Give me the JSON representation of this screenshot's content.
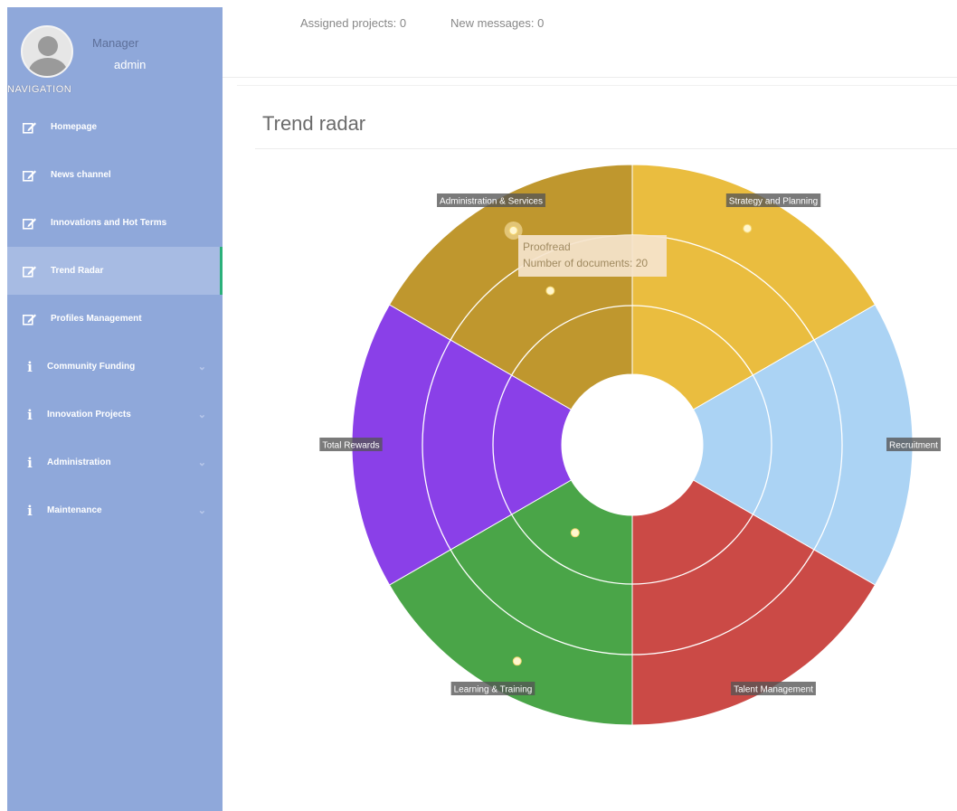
{
  "user": {
    "role": "Manager",
    "name": "admin"
  },
  "nav": {
    "header": "NAVIGATION",
    "items": [
      {
        "label": "Homepage",
        "icon": "edit-icon"
      },
      {
        "label": "News channel",
        "icon": "edit-icon"
      },
      {
        "label": "Innovations and Hot Terms",
        "icon": "edit-icon"
      },
      {
        "label": "Trend Radar",
        "icon": "edit-icon",
        "active": true
      },
      {
        "label": "Profiles Management",
        "icon": "edit-icon"
      },
      {
        "label": "Community Funding",
        "icon": "info-icon",
        "expandable": true
      },
      {
        "label": "Innovation Projects",
        "icon": "info-icon",
        "expandable": true
      },
      {
        "label": "Administration",
        "icon": "info-icon",
        "expandable": true
      },
      {
        "label": "Maintenance",
        "icon": "info-icon",
        "expandable": true
      }
    ]
  },
  "topbar": {
    "assigned": "Assigned projects: 0",
    "messages": "New messages: 0"
  },
  "panel": {
    "title": "Trend radar"
  },
  "tooltip": {
    "line1": "Proofread",
    "line2": "Number of documents: 20"
  },
  "radar": {
    "segments": [
      {
        "label": "Strategy and Planning",
        "color": "#eabd3f"
      },
      {
        "label": "Recruitment",
        "color": "#abd3f4"
      },
      {
        "label": "Talent Management",
        "color": "#cb4a46"
      },
      {
        "label": "Learning & Training",
        "color": "#4aa548"
      },
      {
        "label": "Total Rewards",
        "color": "#8a40e8"
      },
      {
        "label": "Administration & Services",
        "color": "#bf972e"
      }
    ],
    "rings": 3,
    "points": [
      {
        "segment": "Strategy and Planning",
        "ring": 3,
        "angle": 28
      },
      {
        "segment": "Administration & Services",
        "ring": 3,
        "angle": 331,
        "highlighted": true
      },
      {
        "segment": "Administration & Services",
        "ring": 2,
        "angle": 332
      },
      {
        "segment": "Learning & Training",
        "ring": 1,
        "angle": 213
      },
      {
        "segment": "Learning & Training",
        "ring": 3,
        "angle": 208
      }
    ]
  }
}
